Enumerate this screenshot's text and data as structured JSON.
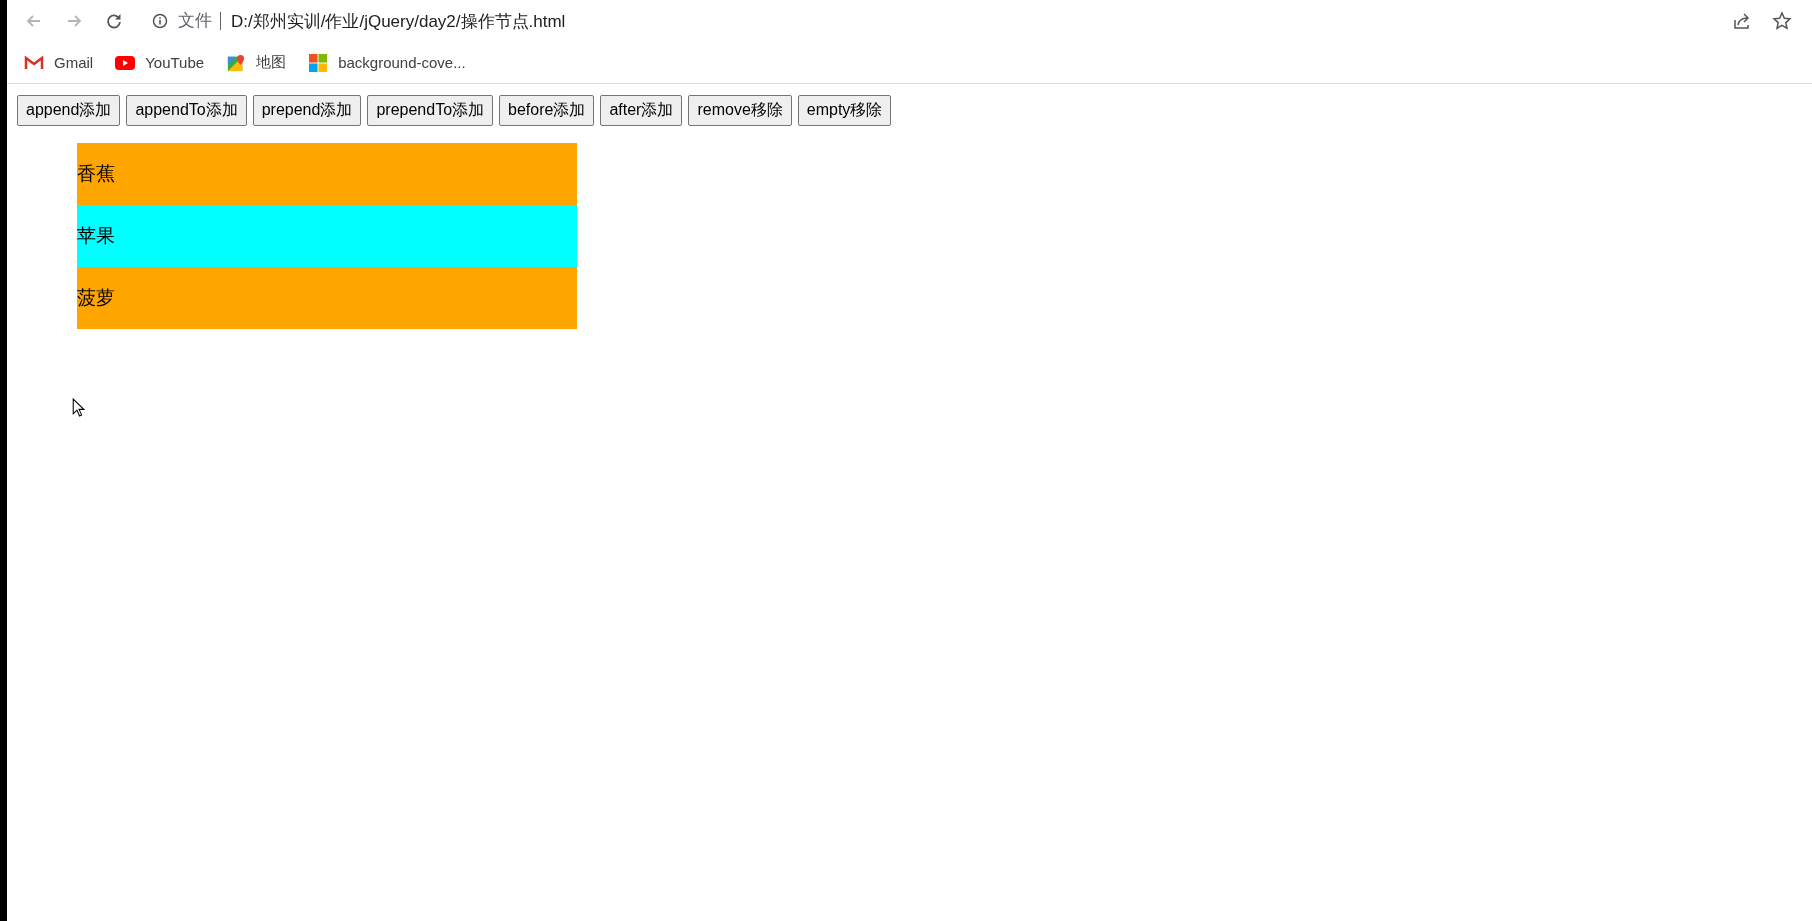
{
  "toolbar": {
    "security_label": "文件",
    "address": "D:/郑州实训/作业/jQuery/day2/操作节点.html"
  },
  "bookmarks": [
    {
      "kind": "gmail",
      "label": "Gmail"
    },
    {
      "kind": "youtube",
      "label": "YouTube"
    },
    {
      "kind": "maps",
      "label": "地图"
    },
    {
      "kind": "windows",
      "label": "background-cove..."
    }
  ],
  "buttons": [
    "append添加",
    "appendTo添加",
    "prepend添加",
    "prependTo添加",
    "before添加",
    "after添加",
    "remove移除",
    "empty移除"
  ],
  "list": [
    {
      "label": "香蕉",
      "color": "#ffa500"
    },
    {
      "label": "苹果",
      "color": "#00ffff"
    },
    {
      "label": "菠萝",
      "color": "#ffa500"
    }
  ]
}
